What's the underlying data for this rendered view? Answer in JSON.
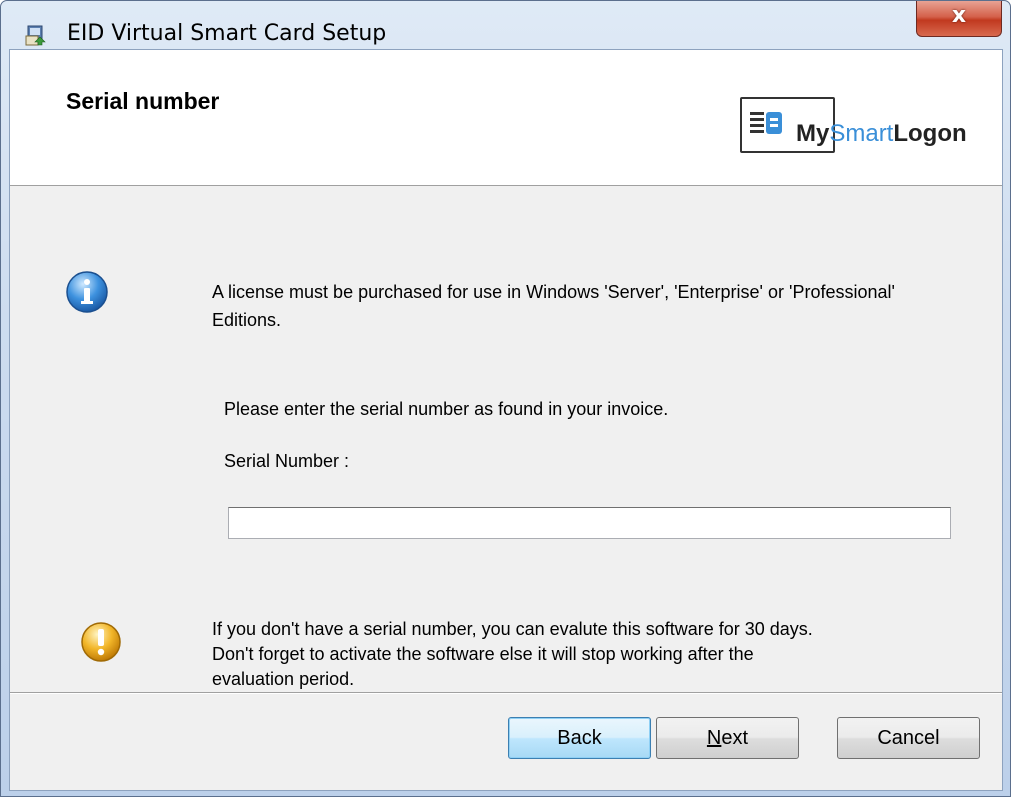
{
  "window": {
    "title": "EID Virtual Smart Card Setup",
    "close_glyph": "x"
  },
  "banner": {
    "title": "Serial number",
    "logo": {
      "part1": "My",
      "part2": "Smart",
      "part3": "Logon"
    }
  },
  "info": {
    "icon": "info-icon",
    "text": "A license must be purchased for use in Windows 'Server', 'Enterprise' or 'Professional' Editions."
  },
  "serial": {
    "prompt": "Please enter the serial number as found in your invoice.",
    "label": "Serial Number :",
    "value": ""
  },
  "warning": {
    "icon": "warning-icon",
    "line1": "If you don't have a serial number, you can evalute this software for 30 days.",
    "line2": "Don't forget  to activate the software else it will stop working after the",
    "line3": "evaluation period."
  },
  "buttons": {
    "back": "Back",
    "next_mnemonic": "N",
    "next_rest": "ext",
    "cancel": "Cancel"
  },
  "colors": {
    "accent": "#3a8fd8",
    "client_bg": "#f0f0f0",
    "close_red": "#c1391f"
  }
}
